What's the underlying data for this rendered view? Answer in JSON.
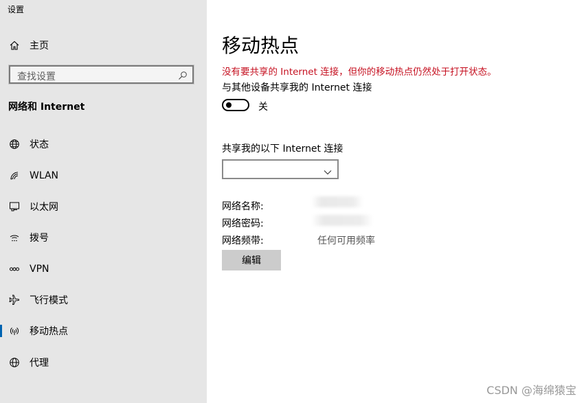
{
  "window": {
    "app_title": "设置"
  },
  "sidebar": {
    "home_label": "主页",
    "search_placeholder": "查找设置",
    "section_title": "网络和 Internet",
    "items": [
      {
        "label": "状态",
        "icon": "globe-icon"
      },
      {
        "label": "WLAN",
        "icon": "wifi-icon"
      },
      {
        "label": "以太网",
        "icon": "ethernet-icon"
      },
      {
        "label": "拨号",
        "icon": "dialup-icon"
      },
      {
        "label": "VPN",
        "icon": "vpn-icon"
      },
      {
        "label": "飞行模式",
        "icon": "airplane-icon"
      },
      {
        "label": "移动热点",
        "icon": "hotspot-icon",
        "selected": true
      },
      {
        "label": "代理",
        "icon": "globe-icon"
      }
    ]
  },
  "main": {
    "title": "移动热点",
    "warning": "没有要共享的 Internet 连接，但你的移动热点仍然处于打开状态。",
    "share_label": "与其他设备共享我的 Internet 连接",
    "toggle": {
      "state_label": "关",
      "on": false
    },
    "connection_label": "共享我的以下 Internet 连接",
    "connection_value": "",
    "network_name_label": "网络名称:",
    "network_password_label": "网络密码:",
    "network_band_label": "网络频带:",
    "network_band_value": "任何可用频率",
    "edit_button": "编辑"
  },
  "watermark": "CSDN @海绵猿宝",
  "colors": {
    "sidebar_bg": "#e6e6e6",
    "warning": "#c50f1f",
    "accent": "#0063b1",
    "button_bg": "#cccccc"
  }
}
